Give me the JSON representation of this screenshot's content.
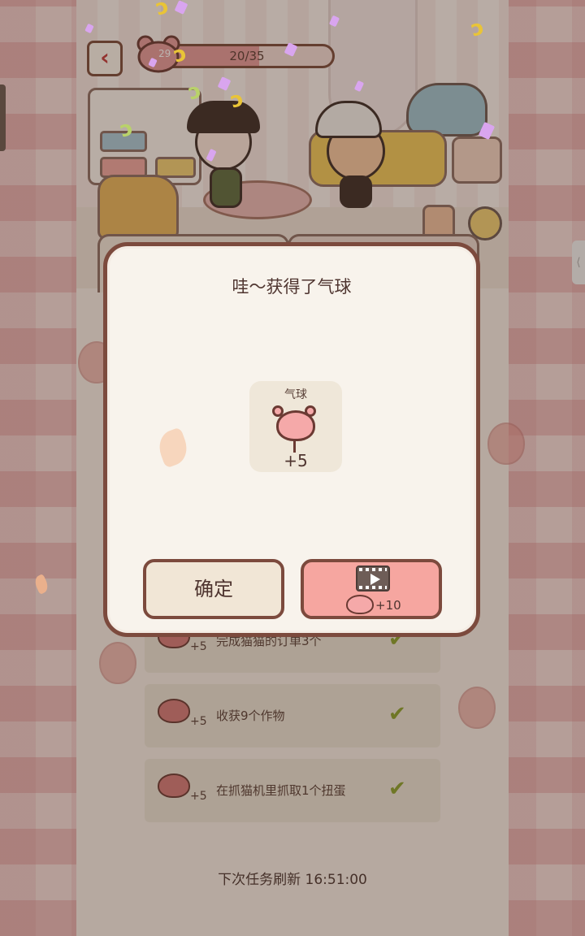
{
  "header": {
    "level": "29",
    "progress_text": "20/35",
    "progress_current": 20,
    "progress_total": 35
  },
  "modal": {
    "title": "哇～获得了气球",
    "reward": {
      "name": "气球",
      "amount": "+5",
      "icon": "balloon-icon"
    },
    "confirm_label": "确定",
    "video_bonus": {
      "icon": "video-icon",
      "amount": "+10"
    }
  },
  "tasks": [
    {
      "reward": "+5",
      "label": "完成猫猫的订单3个",
      "done": true
    },
    {
      "reward": "+5",
      "label": "收获9个作物",
      "done": true
    },
    {
      "reward": "+5",
      "label": "在抓猫机里抓取1个扭蛋",
      "done": true
    }
  ],
  "footer": {
    "refresh_text": "下次任务刷新 16:51:00"
  },
  "colors": {
    "modal_border": "#7c4a3d",
    "video_button": "#f6a6a0",
    "confirm_button": "#f1e6d6",
    "check": "#8aa22b"
  }
}
